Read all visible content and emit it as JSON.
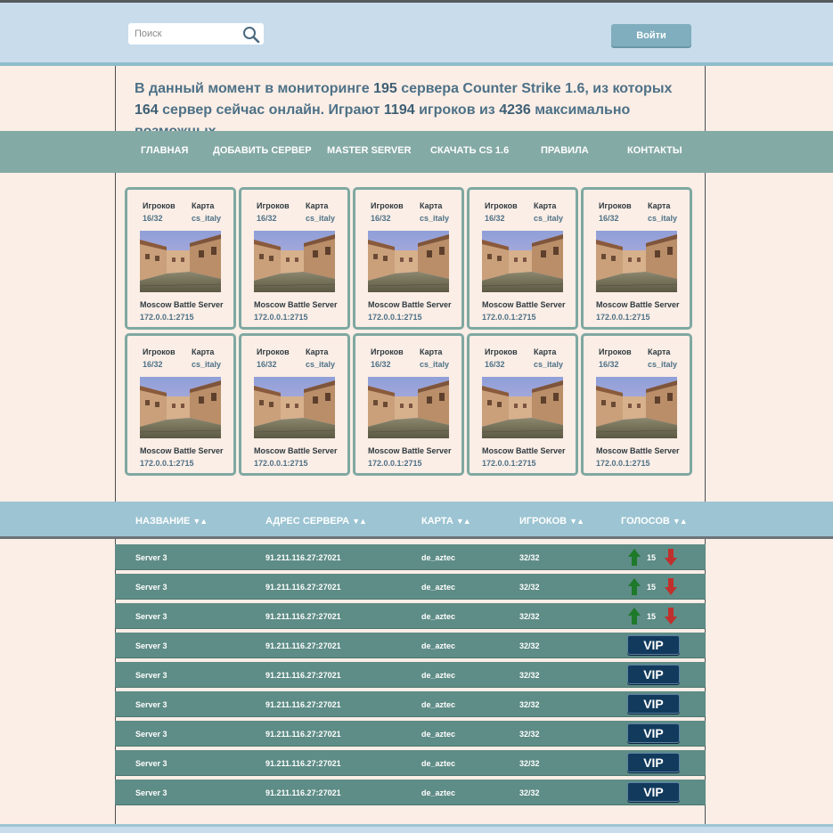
{
  "header": {
    "search_placeholder": "Поиск",
    "login_label": "Войти"
  },
  "stats": {
    "part1": "В данный момент в мониторинге ",
    "servers_total": "195",
    "part2": " сервера Counter Strike 1.6, из которых ",
    "servers_online": "164",
    "part3": " сервер сейчас онлайн. Играют ",
    "players": "1194",
    "part4": " игроков из ",
    "max_players": "4236",
    "part5": " максимально возможных."
  },
  "nav": [
    {
      "label": "ГЛАВНАЯ"
    },
    {
      "label": "ДОБАВИТЬ СЕРВЕР"
    },
    {
      "label": "MASTER SERVER"
    },
    {
      "label": "СКАЧАТЬ CS 1.6"
    },
    {
      "label": "ПРАВИЛА"
    },
    {
      "label": "КОНТАКТЫ"
    }
  ],
  "cards": [
    {
      "players_label": "Игроков",
      "players": "16/32",
      "map_label": "Карта",
      "map": "cs_italy",
      "name": "Moscow Battle Server",
      "address": "172.0.0.1:2715"
    },
    {
      "players_label": "Игроков",
      "players": "16/32",
      "map_label": "Карта",
      "map": "cs_italy",
      "name": "Moscow Battle Server",
      "address": "172.0.0.1:2715"
    },
    {
      "players_label": "Игроков",
      "players": "16/32",
      "map_label": "Карта",
      "map": "cs_italy",
      "name": "Moscow Battle Server",
      "address": "172.0.0.1:2715"
    },
    {
      "players_label": "Игроков",
      "players": "16/32",
      "map_label": "Карта",
      "map": "cs_italy",
      "name": "Moscow Battle Server",
      "address": "172.0.0.1:2715"
    },
    {
      "players_label": "Игроков",
      "players": "16/32",
      "map_label": "Карта",
      "map": "cs_italy",
      "name": "Moscow Battle Server",
      "address": "172.0.0.1:2715"
    },
    {
      "players_label": "Игроков",
      "players": "16/32",
      "map_label": "Карта",
      "map": "cs_italy",
      "name": "Moscow Battle Server",
      "address": "172.0.0.1:2715"
    },
    {
      "players_label": "Игроков",
      "players": "16/32",
      "map_label": "Карта",
      "map": "cs_italy",
      "name": "Moscow Battle Server",
      "address": "172.0.0.1:2715"
    },
    {
      "players_label": "Игроков",
      "players": "16/32",
      "map_label": "Карта",
      "map": "cs_italy",
      "name": "Moscow Battle Server",
      "address": "172.0.0.1:2715"
    },
    {
      "players_label": "Игроков",
      "players": "16/32",
      "map_label": "Карта",
      "map": "cs_italy",
      "name": "Moscow Battle Server",
      "address": "172.0.0.1:2715"
    },
    {
      "players_label": "Игроков",
      "players": "16/32",
      "map_label": "Карта",
      "map": "cs_italy",
      "name": "Moscow Battle Server",
      "address": "172.0.0.1:2715"
    }
  ],
  "table": {
    "columns": [
      {
        "label": "НАЗВАНИЕ",
        "sort": "▼▲"
      },
      {
        "label": "АДРЕС СЕРВЕРА",
        "sort": "▼▲"
      },
      {
        "label": "КАРТА",
        "sort": "▼▲"
      },
      {
        "label": "ИГРОКОВ",
        "sort": "▼▲"
      },
      {
        "label": "ГОЛОСОВ",
        "sort": "▼▲"
      }
    ],
    "rows": [
      {
        "name": "Server 3",
        "address": "91.211.116.27:27021",
        "map": "de_aztec",
        "players": "32/32",
        "votes": "15",
        "vip": null
      },
      {
        "name": "Server 3",
        "address": "91.211.116.27:27021",
        "map": "de_aztec",
        "players": "32/32",
        "votes": "15",
        "vip": null
      },
      {
        "name": "Server 3",
        "address": "91.211.116.27:27021",
        "map": "de_aztec",
        "players": "32/32",
        "votes": "15",
        "vip": null
      },
      {
        "name": "Server 3",
        "address": "91.211.116.27:27021",
        "map": "de_aztec",
        "players": "32/32",
        "votes": null,
        "vip": "VIP"
      },
      {
        "name": "Server 3",
        "address": "91.211.116.27:27021",
        "map": "de_aztec",
        "players": "32/32",
        "votes": null,
        "vip": "VIP"
      },
      {
        "name": "Server 3",
        "address": "91.211.116.27:27021",
        "map": "de_aztec",
        "players": "32/32",
        "votes": null,
        "vip": "VIP"
      },
      {
        "name": "Server 3",
        "address": "91.211.116.27:27021",
        "map": "de_aztec",
        "players": "32/32",
        "votes": null,
        "vip": "VIP"
      },
      {
        "name": "Server 3",
        "address": "91.211.116.27:27021",
        "map": "de_aztec",
        "players": "32/32",
        "votes": null,
        "vip": "VIP"
      },
      {
        "name": "Server 3",
        "address": "91.211.116.27:27021",
        "map": "de_aztec",
        "players": "32/32",
        "votes": null,
        "vip": "VIP"
      }
    ]
  },
  "colors": {
    "header_bg": "#c8dcec",
    "nav_bg": "#84aaa5",
    "row_bg": "#5e8c86",
    "vip_bg": "#113a5c",
    "vote_up": "#1e7a2a",
    "vote_down": "#c0302c"
  }
}
